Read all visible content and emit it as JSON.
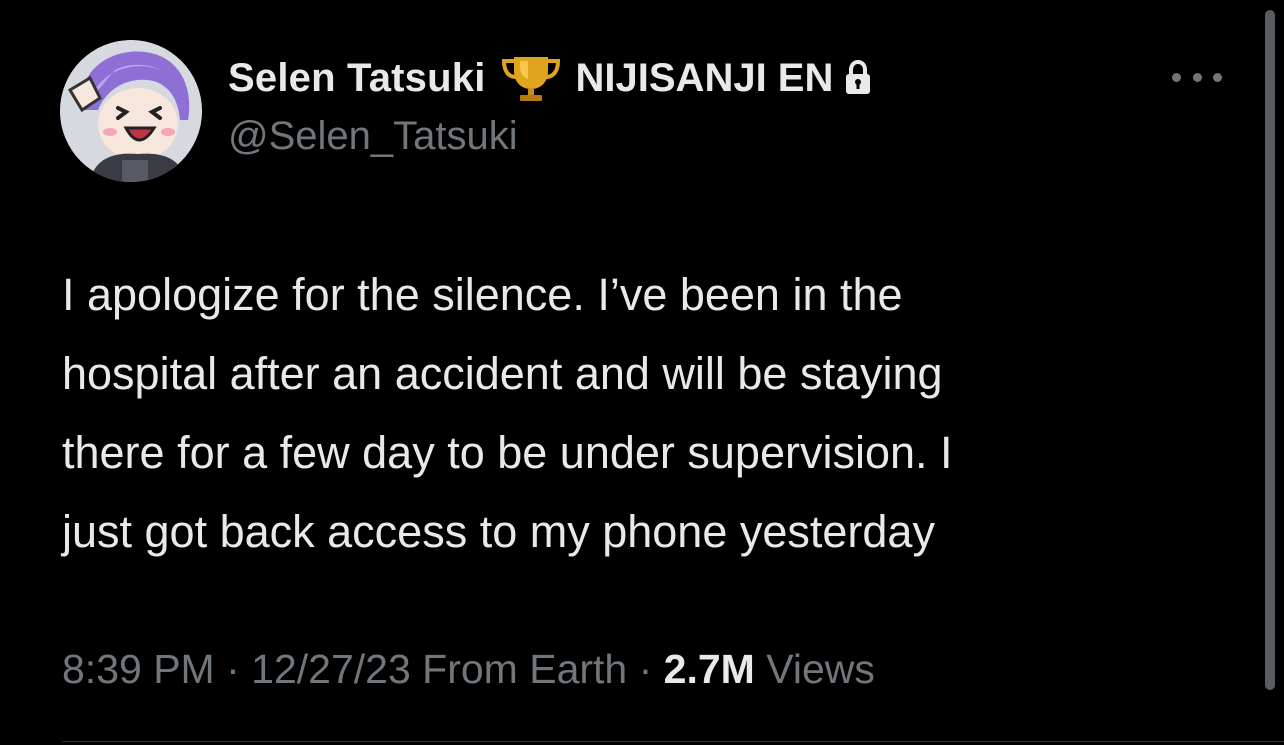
{
  "user": {
    "display_name": "Selen Tatsuki",
    "badge_icon": "trophy-icon",
    "affiliation": "NIJISANJI EN",
    "protected_icon": "lock-icon",
    "handle": "@Selen_Tatsuki"
  },
  "tweet": {
    "text_lines": [
      "I apologize for the silence. I’ve been in the",
      "hospital after an accident and will be staying",
      "there for a few day to be under supervision. I",
      "just got back access to my phone yesterday"
    ],
    "time": "8:39 PM",
    "date": "12/27/23",
    "source": "From Earth",
    "views_count": "2.7M",
    "views_label": "Views"
  },
  "colors": {
    "background": "#000000",
    "text_primary": "#e7e9ea",
    "text_secondary": "#71767b",
    "divider": "#2f3336"
  }
}
